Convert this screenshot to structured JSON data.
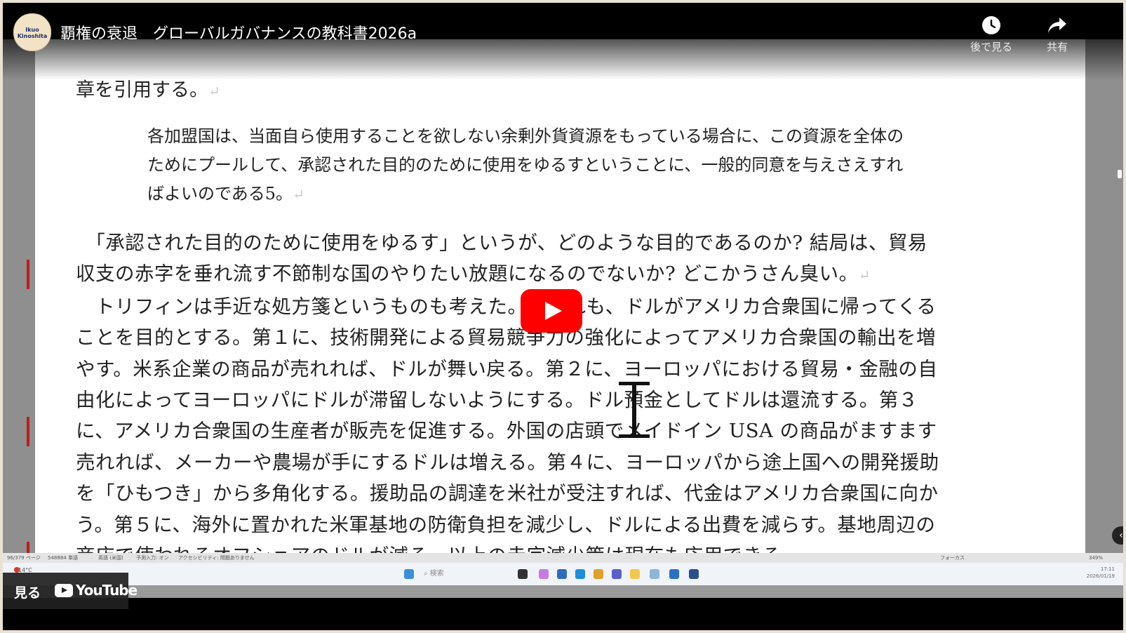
{
  "video": {
    "title": "覇権の衰退　グローバルガバナンスの教科書2026a",
    "channel_avatar_line1": "Ikuo",
    "channel_avatar_line2": "Kinoshita",
    "watch_later_label": "後で見る",
    "share_label": "共有",
    "watch_on_label": "見る",
    "youtube_label": "YouTube"
  },
  "document": {
    "lead_line": "章を引用する。",
    "quote_lines": [
      "各加盟国は、当面自ら使用することを欲しない余剰外貨資源をもっている場合に、この資源を全体の",
      "ためにプールして、承認された目的のために使用をゆるすということに、一般的同意を与えさえすれ",
      "ばよいのである5。"
    ],
    "body_lines": [
      "　「承認された目的のために使用をゆるす」というが、どのような目的であるのか? 結局は、貿易",
      "収支の赤字を垂れ流す不節制な国のやりたい放題になるのでないか? どこかうさん臭い。",
      "　トリフィンは手近な処方箋というものも考えた。いずれも、ドルがアメリカ合衆国に帰ってくる",
      "ことを目的とする。第１に、技術開発による貿易競争力の強化によってアメリカ合衆国の輸出を増",
      "やす。米系企業の商品が売れれば、ドルが舞い戻る。第２に、ヨーロッパにおける貿易・金融の自",
      "由化によってヨーロッパにドルが滞留しないようにする。ドル預金としてドルは還流する。第３",
      "に、アメリカ合衆国の生産者が販売を促進する。外国の店頭でメイドイン USA の商品がますます",
      "売れれば、メーカーや農場が手にするドルは増える。第４に、ヨーロッパから途上国への開発援助",
      "を「ひもつき」から多角化する。援助品の調達を米社が受注すれば、代金はアメリカ合衆国に向か",
      "う。第５に、海外に置かれた米軍基地の防衛負担を減少し、ドルによる出費を減らす。基地周辺の",
      "商店で使われるオフショアのドルが減る。以上の赤字減少策は現在も応用できる。"
    ]
  },
  "statusbar": {
    "page": "96/379 ページ",
    "words": "548884 単語",
    "language": "英語 (米国)",
    "input_mode": "予測入力: オン",
    "accessibility": "アクセシビリティ: 問題ありません",
    "focus": "フォーカス",
    "zoom": "349%"
  },
  "taskbar": {
    "weather": "14°C",
    "search_placeholder": "検索",
    "clock_time": "17:11",
    "clock_date": "2026/01/19"
  },
  "icons": [
    "watch-later-clock-icon",
    "share-arrow-icon",
    "play-icon",
    "youtube-logo-icon",
    "text-cursor-icon"
  ],
  "colors": {
    "revision_bar": "#c21a1a",
    "play_button": "#ff0000"
  }
}
